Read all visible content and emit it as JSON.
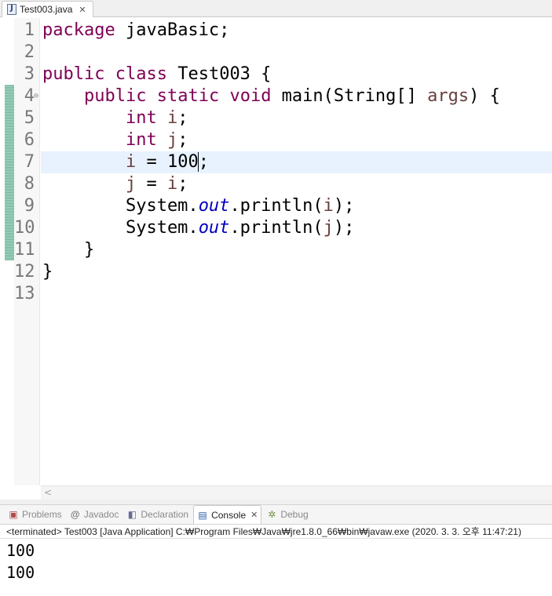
{
  "editor": {
    "tab": {
      "filename": "Test003.java",
      "icon_letter": "J",
      "close_glyph": "✕"
    },
    "current_line": 7,
    "lines": [
      {
        "number": "1",
        "tokens": [
          {
            "t": "kw",
            "s": "package"
          },
          {
            "t": "plain",
            "s": " javaBasic;"
          }
        ]
      },
      {
        "number": "2",
        "tokens": []
      },
      {
        "number": "3",
        "tokens": [
          {
            "t": "kw",
            "s": "public"
          },
          {
            "t": "plain",
            "s": " "
          },
          {
            "t": "kw",
            "s": "class"
          },
          {
            "t": "plain",
            "s": " Test003 {"
          }
        ]
      },
      {
        "number": "4",
        "fold": true,
        "tokens": [
          {
            "t": "plain",
            "s": "    "
          },
          {
            "t": "kw",
            "s": "public"
          },
          {
            "t": "plain",
            "s": " "
          },
          {
            "t": "kw",
            "s": "static"
          },
          {
            "t": "plain",
            "s": " "
          },
          {
            "t": "kw",
            "s": "void"
          },
          {
            "t": "plain",
            "s": " main(String[] "
          },
          {
            "t": "param",
            "s": "args"
          },
          {
            "t": "plain",
            "s": ") {"
          }
        ]
      },
      {
        "number": "5",
        "tokens": [
          {
            "t": "plain",
            "s": "        "
          },
          {
            "t": "kw",
            "s": "int"
          },
          {
            "t": "plain",
            "s": " "
          },
          {
            "t": "param",
            "s": "i"
          },
          {
            "t": "plain",
            "s": ";"
          }
        ]
      },
      {
        "number": "6",
        "tokens": [
          {
            "t": "plain",
            "s": "        "
          },
          {
            "t": "kw",
            "s": "int"
          },
          {
            "t": "plain",
            "s": " "
          },
          {
            "t": "param",
            "s": "j"
          },
          {
            "t": "plain",
            "s": ";"
          }
        ]
      },
      {
        "number": "7",
        "tokens": [
          {
            "t": "plain",
            "s": "        "
          },
          {
            "t": "param",
            "s": "i"
          },
          {
            "t": "plain",
            "s": " = 100"
          },
          {
            "t": "caret",
            "s": ""
          },
          {
            "t": "plain",
            "s": ";"
          }
        ]
      },
      {
        "number": "8",
        "tokens": [
          {
            "t": "plain",
            "s": "        "
          },
          {
            "t": "param",
            "s": "j"
          },
          {
            "t": "plain",
            "s": " = "
          },
          {
            "t": "param",
            "s": "i"
          },
          {
            "t": "plain",
            "s": ";"
          }
        ]
      },
      {
        "number": "9",
        "tokens": [
          {
            "t": "plain",
            "s": "        System."
          },
          {
            "t": "static",
            "s": "out"
          },
          {
            "t": "plain",
            "s": ".println("
          },
          {
            "t": "param",
            "s": "i"
          },
          {
            "t": "plain",
            "s": ");"
          }
        ]
      },
      {
        "number": "10",
        "tokens": [
          {
            "t": "plain",
            "s": "        System."
          },
          {
            "t": "static",
            "s": "out"
          },
          {
            "t": "plain",
            "s": ".println("
          },
          {
            "t": "param",
            "s": "j"
          },
          {
            "t": "plain",
            "s": ");"
          }
        ]
      },
      {
        "number": "11",
        "tokens": [
          {
            "t": "plain",
            "s": "    }"
          }
        ]
      },
      {
        "number": "12",
        "tokens": [
          {
            "t": "plain",
            "s": "}"
          }
        ]
      },
      {
        "number": "13",
        "tokens": []
      }
    ],
    "scroll_left_glyph": "<"
  },
  "views": {
    "tabs": [
      {
        "label": "Problems",
        "icon": "problems-icon",
        "glyph": "▣",
        "active": false
      },
      {
        "label": "Javadoc",
        "icon": "javadoc-icon",
        "glyph": "@",
        "active": false
      },
      {
        "label": "Declaration",
        "icon": "declaration-icon",
        "glyph": "◧",
        "active": false
      },
      {
        "label": "Console",
        "icon": "console-icon",
        "glyph": "▤",
        "active": true
      },
      {
        "label": "Debug",
        "icon": "debug-icon",
        "glyph": "✲",
        "active": false
      }
    ],
    "close_glyph": "✕"
  },
  "console": {
    "status": "<terminated> Test003 [Java Application] C:₩Program Files₩Java₩jre1.8.0_66₩bin₩javaw.exe (2020. 3. 3. 오후 11:47:21)",
    "output": [
      "100",
      "100"
    ]
  },
  "colors": {
    "keyword": "#7f0055",
    "local_variable": "#6a3e3e",
    "static_field": "#0000c0",
    "current_line": "#e8f2fe",
    "change_ruler": "#71b59a"
  }
}
